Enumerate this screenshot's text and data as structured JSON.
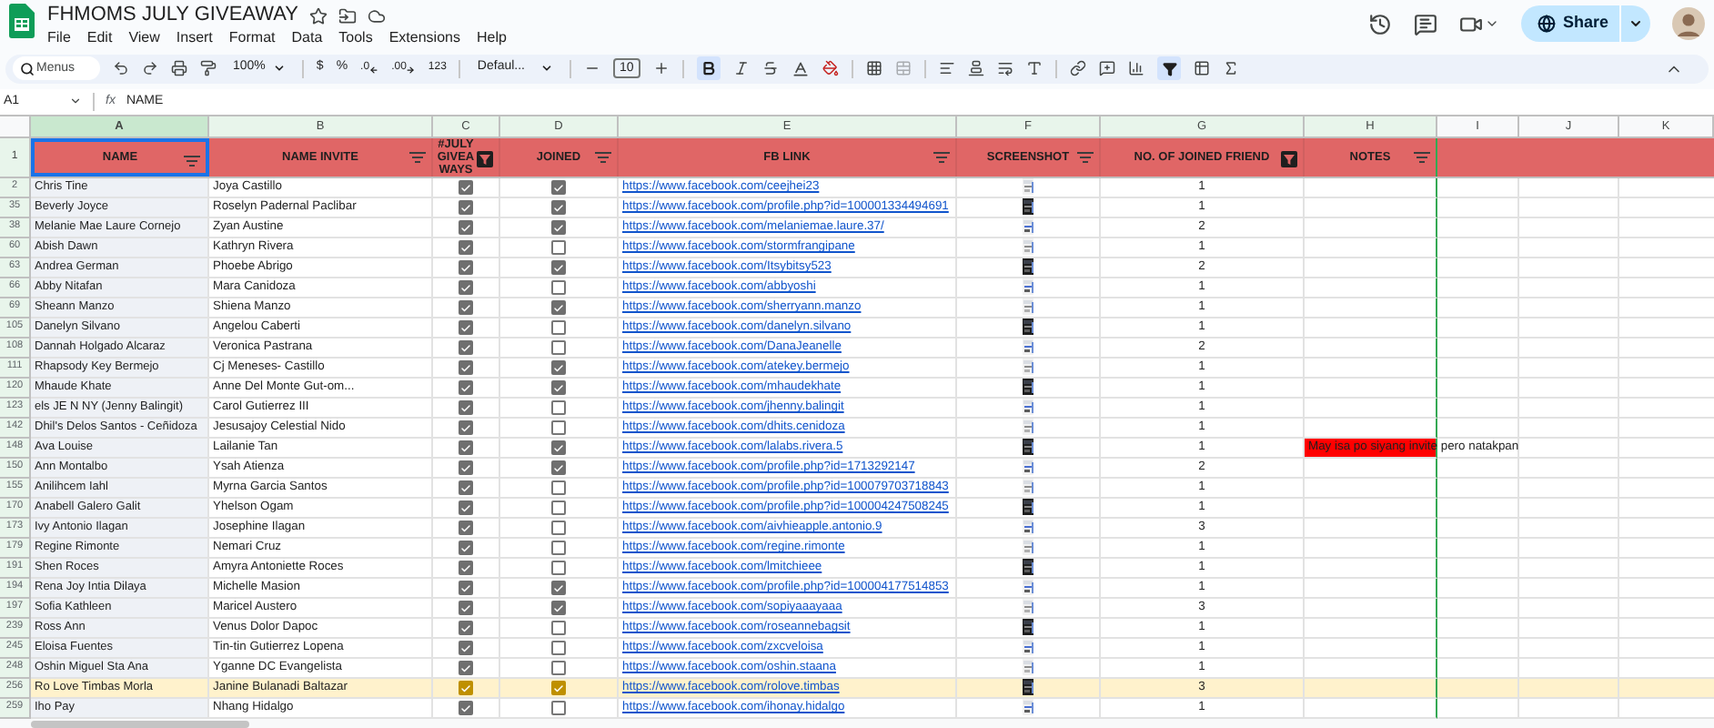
{
  "document": {
    "title": "FHMOMS JULY GIVEAWAY"
  },
  "menu": [
    "File",
    "Edit",
    "View",
    "Insert",
    "Format",
    "Data",
    "Tools",
    "Extensions",
    "Help"
  ],
  "share": {
    "label": "Share"
  },
  "toolbar": {
    "search_placeholder": "Menus",
    "zoom": "100%",
    "currency": "$",
    "percent": "%",
    "decrease_decimal": ".0",
    "increase_decimal": ".00",
    "number_format": "123",
    "font": "Defaul...",
    "font_size": "10",
    "bold_selected": true,
    "filter_selected": true
  },
  "formula_bar": {
    "cell": "A1",
    "function_label": "fx",
    "value": "NAME"
  },
  "columns": [
    {
      "letter": "A",
      "selected": true
    },
    {
      "letter": "B",
      "selected": false
    },
    {
      "letter": "C",
      "selected": false
    },
    {
      "letter": "D",
      "selected": false
    },
    {
      "letter": "E",
      "selected": false
    },
    {
      "letter": "F",
      "selected": false
    },
    {
      "letter": "G",
      "selected": false
    },
    {
      "letter": "H",
      "selected": false
    },
    {
      "letter": "I",
      "selected": false
    },
    {
      "letter": "J",
      "selected": false
    },
    {
      "letter": "K",
      "selected": false
    }
  ],
  "header_row": {
    "number": "1",
    "cells": [
      {
        "label": "NAME",
        "filter_active": false
      },
      {
        "label": "NAME INVITE",
        "filter_active": false
      },
      {
        "label": "#JULY GIVEAWAYS",
        "filter_active": true
      },
      {
        "label": "JOINED",
        "filter_active": false
      },
      {
        "label": "FB LINK",
        "filter_active": false
      },
      {
        "label": "SCREENSHOT",
        "filter_active": false
      },
      {
        "label": "NO. OF JOINED FRIEND",
        "filter_active": true
      },
      {
        "label": "NOTES",
        "filter_active": false
      }
    ]
  },
  "rows": [
    {
      "number": "2",
      "name": "Chris Tine",
      "invite": "Joya Castillo",
      "giveaway": true,
      "joined": true,
      "fb_link": "https://www.facebook.com/ceejhei23",
      "friends": "1",
      "highlighted": false
    },
    {
      "number": "35",
      "name": "Beverly Joyce",
      "invite": "Roselyn Padernal Paclibar",
      "giveaway": true,
      "joined": true,
      "fb_link": "https://www.facebook.com/profile.php?id=100001334494691",
      "friends": "1",
      "highlighted": false
    },
    {
      "number": "38",
      "name": "Melanie Mae Laure Cornejo",
      "invite": "Zyan Austine",
      "giveaway": true,
      "joined": true,
      "fb_link": "https://www.facebook.com/melaniemae.laure.37/",
      "friends": "2",
      "highlighted": false
    },
    {
      "number": "60",
      "name": "Abish Dawn",
      "invite": "Kathryn Rivera",
      "giveaway": true,
      "joined": false,
      "fb_link": "https://www.facebook.com/stormfrangipane",
      "friends": "1",
      "highlighted": false
    },
    {
      "number": "63",
      "name": "Andrea German",
      "invite": "Phoebe Abrigo",
      "giveaway": true,
      "joined": true,
      "fb_link": "https://www.facebook.com/Itsybitsy523",
      "friends": "2",
      "highlighted": false
    },
    {
      "number": "66",
      "name": "Abby Nitafan",
      "invite": "Mara Canidoza",
      "giveaway": true,
      "joined": false,
      "fb_link": "https://www.facebook.com/abbyoshi",
      "friends": "1",
      "highlighted": false
    },
    {
      "number": "69",
      "name": "Sheann Manzo",
      "invite": "Shiena Manzo",
      "giveaway": true,
      "joined": true,
      "fb_link": "https://www.facebook.com/sherryann.manzo",
      "friends": "1",
      "highlighted": false
    },
    {
      "number": "105",
      "name": "Danelyn Silvano",
      "invite": "Angelou Caberti",
      "giveaway": true,
      "joined": false,
      "fb_link": "https://www.facebook.com/danelyn.silvano",
      "friends": "1",
      "highlighted": false
    },
    {
      "number": "108",
      "name": "Dannah Holgado Alcaraz",
      "invite": "Veronica Pastrana",
      "giveaway": true,
      "joined": false,
      "fb_link": "https://www.facebook.com/DanaJeanelle",
      "friends": "2",
      "highlighted": false
    },
    {
      "number": "111",
      "name": "Rhapsody Key Bermejo",
      "invite": "Cj Meneses- Castillo",
      "giveaway": true,
      "joined": true,
      "fb_link": "https://www.facebook.com/atekey.bermejo",
      "friends": "1",
      "highlighted": false
    },
    {
      "number": "120",
      "name": "Mhaude Khate",
      "invite": "Anne Del Monte Gut-om...",
      "giveaway": true,
      "joined": true,
      "fb_link": "https://www.facebook.com/mhaudekhate",
      "friends": "1",
      "highlighted": false
    },
    {
      "number": "123",
      "name": "els JE N NY (Jenny Balingit)",
      "invite": "Carol Gutierrez III",
      "giveaway": true,
      "joined": false,
      "fb_link": "https://www.facebook.com/jhenny.balingit",
      "friends": "1",
      "highlighted": false
    },
    {
      "number": "142",
      "name": "Dhil's Delos Santos - Ceñidoza",
      "invite": "Jesusajoy Celestial Nido",
      "giveaway": true,
      "joined": false,
      "fb_link": "https://www.facebook.com/dhits.cenidoza",
      "friends": "1",
      "highlighted": false
    },
    {
      "number": "148",
      "name": "Ava Louise",
      "invite": "Lailanie Tan",
      "giveaway": true,
      "joined": true,
      "fb_link": "https://www.facebook.com/lalabs.rivera.5",
      "friends": "1",
      "highlighted": false,
      "note": "May isa po siyang invite pero natakpan"
    },
    {
      "number": "150",
      "name": "Ann Montalbo",
      "invite": "Ysah Atienza",
      "giveaway": true,
      "joined": true,
      "fb_link": "https://www.facebook.com/profile.php?id=1713292147",
      "friends": "2",
      "highlighted": false
    },
    {
      "number": "155",
      "name": "Anilihcem Iahl",
      "invite": "Myrna Garcia Santos",
      "giveaway": true,
      "joined": false,
      "fb_link": "https://www.facebook.com/profile.php?id=100079703718843",
      "friends": "1",
      "highlighted": false
    },
    {
      "number": "170",
      "name": "Anabell Galero Galit",
      "invite": "Yhelson Ogam",
      "giveaway": true,
      "joined": false,
      "fb_link": "https://www.facebook.com/profile.php?id=100004247508245",
      "friends": "1",
      "highlighted": false
    },
    {
      "number": "173",
      "name": "Ivy Antonio Ilagan",
      "invite": "Josephine Ilagan",
      "giveaway": true,
      "joined": false,
      "fb_link": "https://www.facebook.com/aivhieapple.antonio.9",
      "friends": "3",
      "highlighted": false
    },
    {
      "number": "179",
      "name": "Regine Rimonte",
      "invite": "Nemari Cruz",
      "giveaway": true,
      "joined": false,
      "fb_link": "https://www.facebook.com/regine.rimonte",
      "friends": "1",
      "highlighted": false
    },
    {
      "number": "191",
      "name": "Shen Roces",
      "invite": "Amyra Antoniette Roces",
      "giveaway": true,
      "joined": false,
      "fb_link": "https://www.facebook.com/lmitchieee",
      "friends": "1",
      "highlighted": false
    },
    {
      "number": "194",
      "name": "Rena Joy Intia Dilaya",
      "invite": "Michelle Masion",
      "giveaway": true,
      "joined": true,
      "fb_link": "https://www.facebook.com/profile.php?id=100004177514853",
      "friends": "1",
      "highlighted": false
    },
    {
      "number": "197",
      "name": "Sofia Kathleen",
      "invite": "Maricel Austero",
      "giveaway": true,
      "joined": true,
      "fb_link": "https://www.facebook.com/sopiyaaayaaa",
      "friends": "3",
      "highlighted": false
    },
    {
      "number": "239",
      "name": "Ross Ann",
      "invite": "Venus Dolor Dapoc",
      "giveaway": true,
      "joined": false,
      "fb_link": "https://www.facebook.com/roseannebagsit",
      "friends": "1",
      "highlighted": false
    },
    {
      "number": "245",
      "name": "Eloisa Fuentes",
      "invite": "Tin-tin Gutierrez Lopena",
      "giveaway": true,
      "joined": false,
      "fb_link": "https://www.facebook.com/zxcveloisa",
      "friends": "1",
      "highlighted": false
    },
    {
      "number": "248",
      "name": "Oshin Miguel Sta Ana",
      "invite": "Yganne DC Evangelista",
      "giveaway": true,
      "joined": false,
      "fb_link": "https://www.facebook.com/oshin.staana",
      "friends": "1",
      "highlighted": false
    },
    {
      "number": "256",
      "name": "Ro Love Timbas Morla",
      "invite": "Janine Bulanadi Baltazar",
      "giveaway": true,
      "joined": true,
      "fb_link": "https://www.facebook.com/rolove.timbas",
      "friends": "3",
      "highlighted": true
    },
    {
      "number": "259",
      "name": "Iho Pay",
      "invite": "Nhang Hidalgo",
      "giveaway": true,
      "joined": false,
      "fb_link": "https://www.facebook.com/ihonay.hidalgo",
      "friends": "1",
      "highlighted": false
    }
  ]
}
